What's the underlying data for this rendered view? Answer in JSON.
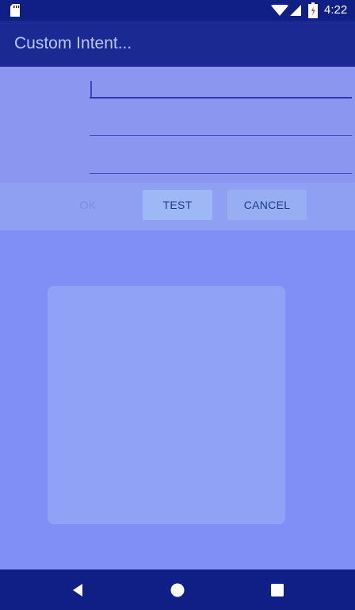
{
  "status_bar": {
    "time": "4:22",
    "icons": {
      "sd_card": "sd-card-icon",
      "wifi": "wifi-icon",
      "signal": "cellular-signal-icon",
      "battery": "battery-icon"
    }
  },
  "app_bar": {
    "title": "Custom Intent..."
  },
  "dialog": {
    "buttons": {
      "ok_label": "OK",
      "test_label": "TEST",
      "cancel_label": "CANCEL"
    }
  },
  "nav_bar": {
    "icons": {
      "back": "back-icon",
      "home": "home-icon",
      "recents": "recents-icon"
    }
  },
  "colors": {
    "status_bar_bg": "#0f1f86",
    "app_bar_bg": "#1b2a93",
    "accent": "#3448c8"
  }
}
